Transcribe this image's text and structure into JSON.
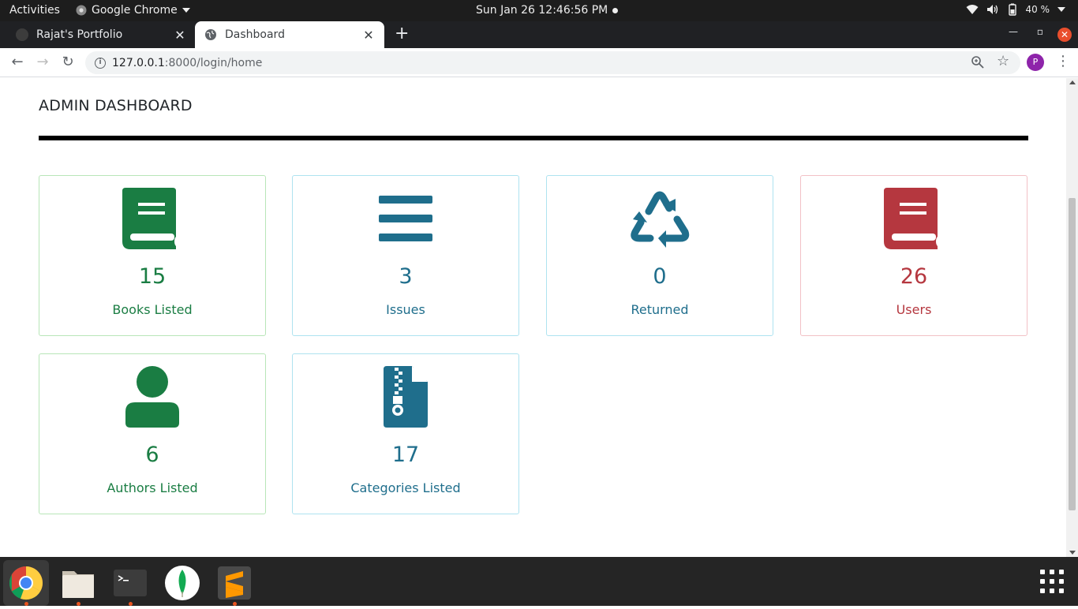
{
  "system_bar": {
    "activities": "Activities",
    "app_name": "Google Chrome",
    "clock": "Sun Jan 26  12:46:56 PM",
    "battery": "40 %"
  },
  "browser": {
    "tabs": [
      {
        "label": "Rajat's Portfolio",
        "active": false
      },
      {
        "label": "Dashboard",
        "active": true
      }
    ],
    "url_host": "127.0.0.1",
    "url_path": ":8000/login/home",
    "profile_initial": "P"
  },
  "page": {
    "title": "ADMIN DASHBOARD",
    "cards": [
      {
        "count": "15",
        "label": "Books Listed",
        "icon": "book-icon",
        "color": "#1a7d43",
        "border": "#b8e6b8"
      },
      {
        "count": "3",
        "label": "Issues",
        "icon": "list-icon",
        "color": "#1f6e8c",
        "border": "#aee3f0"
      },
      {
        "count": "0",
        "label": "Returned",
        "icon": "recycle-icon",
        "color": "#1f6e8c",
        "border": "#aee3f0"
      },
      {
        "count": "26",
        "label": "Users",
        "icon": "book-icon",
        "color": "#b5373f",
        "border": "#f2c1c6"
      },
      {
        "count": "6",
        "label": "Authors Listed",
        "icon": "user-icon",
        "color": "#1a7d43",
        "border": "#b8e6b8"
      },
      {
        "count": "17",
        "label": "Categories Listed",
        "icon": "file-archive-icon",
        "color": "#1f6e8c",
        "border": "#aee3f0"
      }
    ]
  },
  "dock": {
    "apps": [
      "chrome-icon",
      "files-icon",
      "terminal-icon",
      "mongodb-compass-icon",
      "sublime-text-icon"
    ]
  }
}
